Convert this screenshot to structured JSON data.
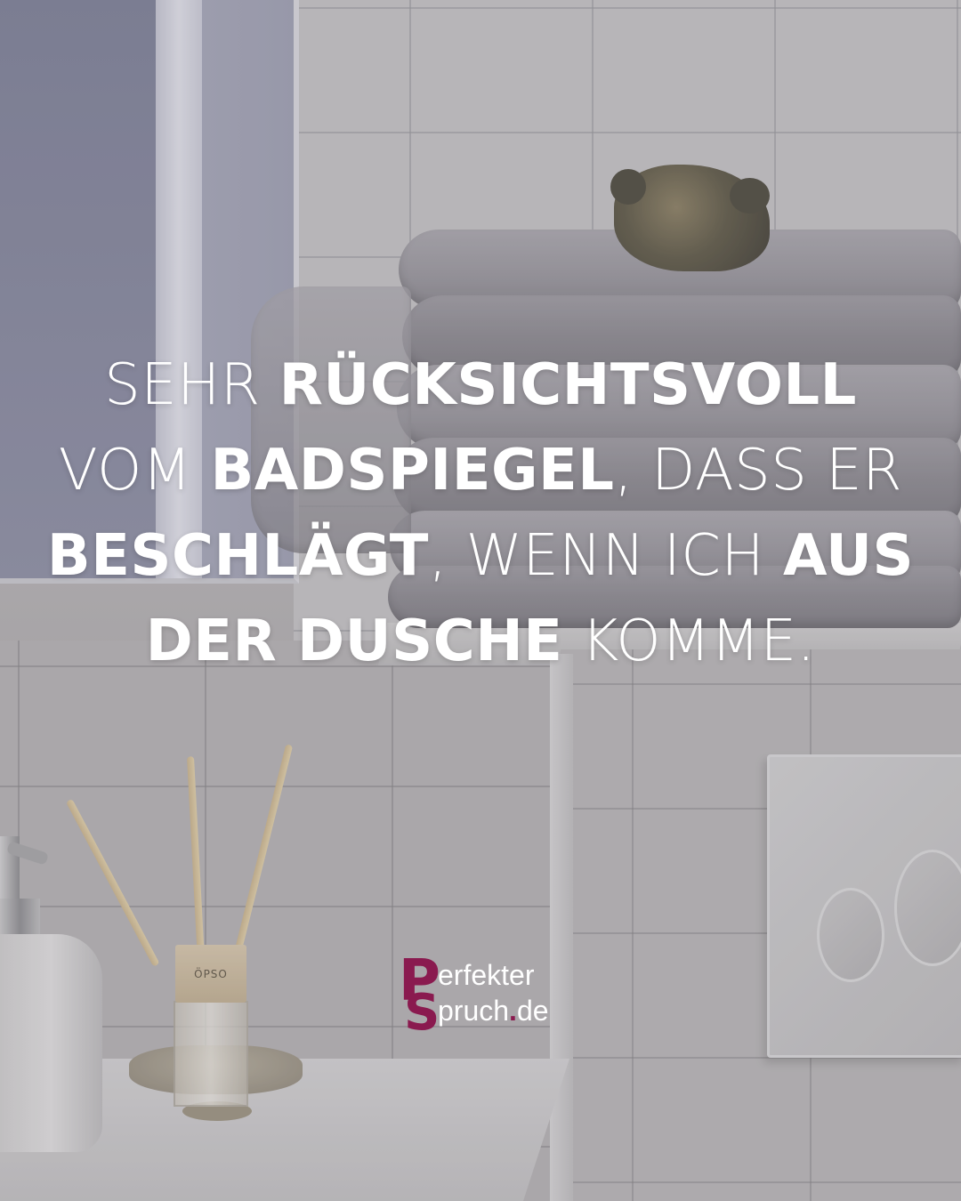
{
  "quote": {
    "lines": [
      [
        {
          "text": "SEHR ",
          "weight": "thin"
        },
        {
          "text": "RÜCKSICHTSVOLL",
          "weight": "bold"
        }
      ],
      [
        {
          "text": "VOM ",
          "weight": "thin"
        },
        {
          "text": "BADSPIEGEL",
          "weight": "bold"
        },
        {
          "text": ", DASS ER",
          "weight": "thin"
        }
      ],
      [
        {
          "text": "BESCHLÄGT",
          "weight": "bold"
        },
        {
          "text": ", WENN ICH ",
          "weight": "thin"
        },
        {
          "text": "AUS",
          "weight": "bold"
        }
      ],
      [
        {
          "text": "DER DUSCHE",
          "weight": "bold"
        },
        {
          "text": " KOMME.",
          "weight": "thin"
        }
      ]
    ]
  },
  "logo": {
    "letter_p": "P",
    "letter_s": "S",
    "line1": "erfekter",
    "line2_a": "pruch",
    "line2_dot": ".",
    "line2_b": "de",
    "brand_color": "#8a1a4f"
  },
  "product_label": "ÖPSO",
  "colors": {
    "text": "#ffffff",
    "accent": "#8a1a4f"
  }
}
